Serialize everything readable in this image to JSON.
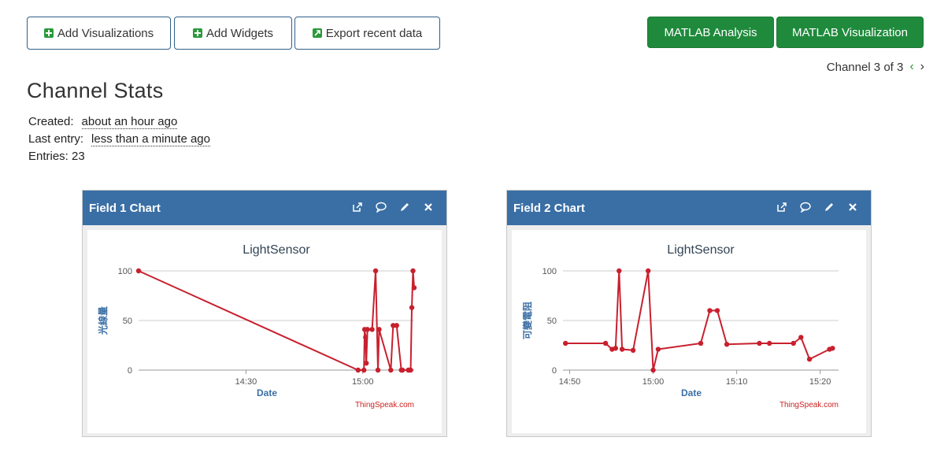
{
  "toolbar": {
    "add_visualizations": "Add Visualizations",
    "add_widgets": "Add Widgets",
    "export_recent_data": "Export recent data",
    "matlab_analysis": "MATLAB Analysis",
    "matlab_visualization": "MATLAB Visualization"
  },
  "channel_nav": {
    "label": "Channel 3 of 3",
    "prev_icon": "chevron-left-icon",
    "next_icon": "chevron-right-icon"
  },
  "stats": {
    "title": "Channel Stats",
    "created_label": "Created:",
    "created_value": "about an hour ago",
    "last_entry_label": "Last entry:",
    "last_entry_value": "less than a minute ago",
    "entries_label": "Entries: 23"
  },
  "colors": {
    "header": "#3a6fa5",
    "line": "#c8202e",
    "green": "#1f8a3c",
    "axis_label": "#3a6fa5"
  },
  "panels": [
    {
      "title": "Field 1 Chart",
      "icons": [
        "external-link-icon",
        "comment-icon",
        "pencil-icon",
        "close-icon"
      ]
    },
    {
      "title": "Field 2 Chart",
      "icons": [
        "external-link-icon",
        "comment-icon",
        "pencil-icon",
        "close-icon"
      ]
    }
  ],
  "chart_data": [
    {
      "type": "line",
      "title": "LightSensor",
      "xlabel": "Date",
      "ylabel": "光線量",
      "credit": "ThingSpeak.com",
      "ylim": [
        0,
        100
      ],
      "yticks": [
        "0",
        "50",
        "100"
      ],
      "xticks": [
        {
          "label": "14:30",
          "t": 14.5
        },
        {
          "label": "15:00",
          "t": 15.0
        }
      ],
      "xlim_hours": [
        14.04,
        15.22
      ],
      "x_hours": [
        14.04,
        14.98,
        15.005,
        15.008,
        15.012,
        15.015,
        15.02,
        15.04,
        15.055,
        15.065,
        15.07,
        15.12,
        15.13,
        15.145,
        15.165,
        15.17,
        15.195,
        15.2,
        15.205,
        15.21,
        15.215,
        15.22
      ],
      "values": [
        100,
        0,
        0,
        41,
        33,
        7,
        41,
        41,
        100,
        0,
        41,
        0,
        45,
        45,
        0,
        0,
        0,
        0,
        0,
        63,
        100,
        83
      ],
      "series": [
        {
          "name": "",
          "color": "#c8202e"
        }
      ]
    },
    {
      "type": "line",
      "title": "LightSensor",
      "xlabel": "Date",
      "ylabel": "可變電阻",
      "credit": "ThingSpeak.com",
      "ylim": [
        0,
        100
      ],
      "yticks": [
        "0",
        "50",
        "100"
      ],
      "xticks": [
        {
          "label": "14:50",
          "t": 14.8333
        },
        {
          "label": "15:00",
          "t": 15.0
        },
        {
          "label": "15:10",
          "t": 15.1667
        },
        {
          "label": "15:20",
          "t": 15.3333
        }
      ],
      "xlim_hours": [
        14.82,
        15.37
      ],
      "x_hours": [
        14.825,
        14.905,
        14.918,
        14.925,
        14.932,
        14.938,
        14.96,
        14.99,
        15.0,
        15.01,
        15.095,
        15.113,
        15.128,
        15.147,
        15.212,
        15.232,
        15.28,
        15.295,
        15.312,
        15.352,
        15.358
      ],
      "values": [
        27,
        27,
        21,
        22,
        100,
        21,
        20,
        100,
        0,
        21,
        27,
        60,
        60,
        26,
        27,
        27,
        27,
        33,
        11,
        21,
        22
      ],
      "series": [
        {
          "name": "",
          "color": "#c8202e"
        }
      ]
    }
  ]
}
